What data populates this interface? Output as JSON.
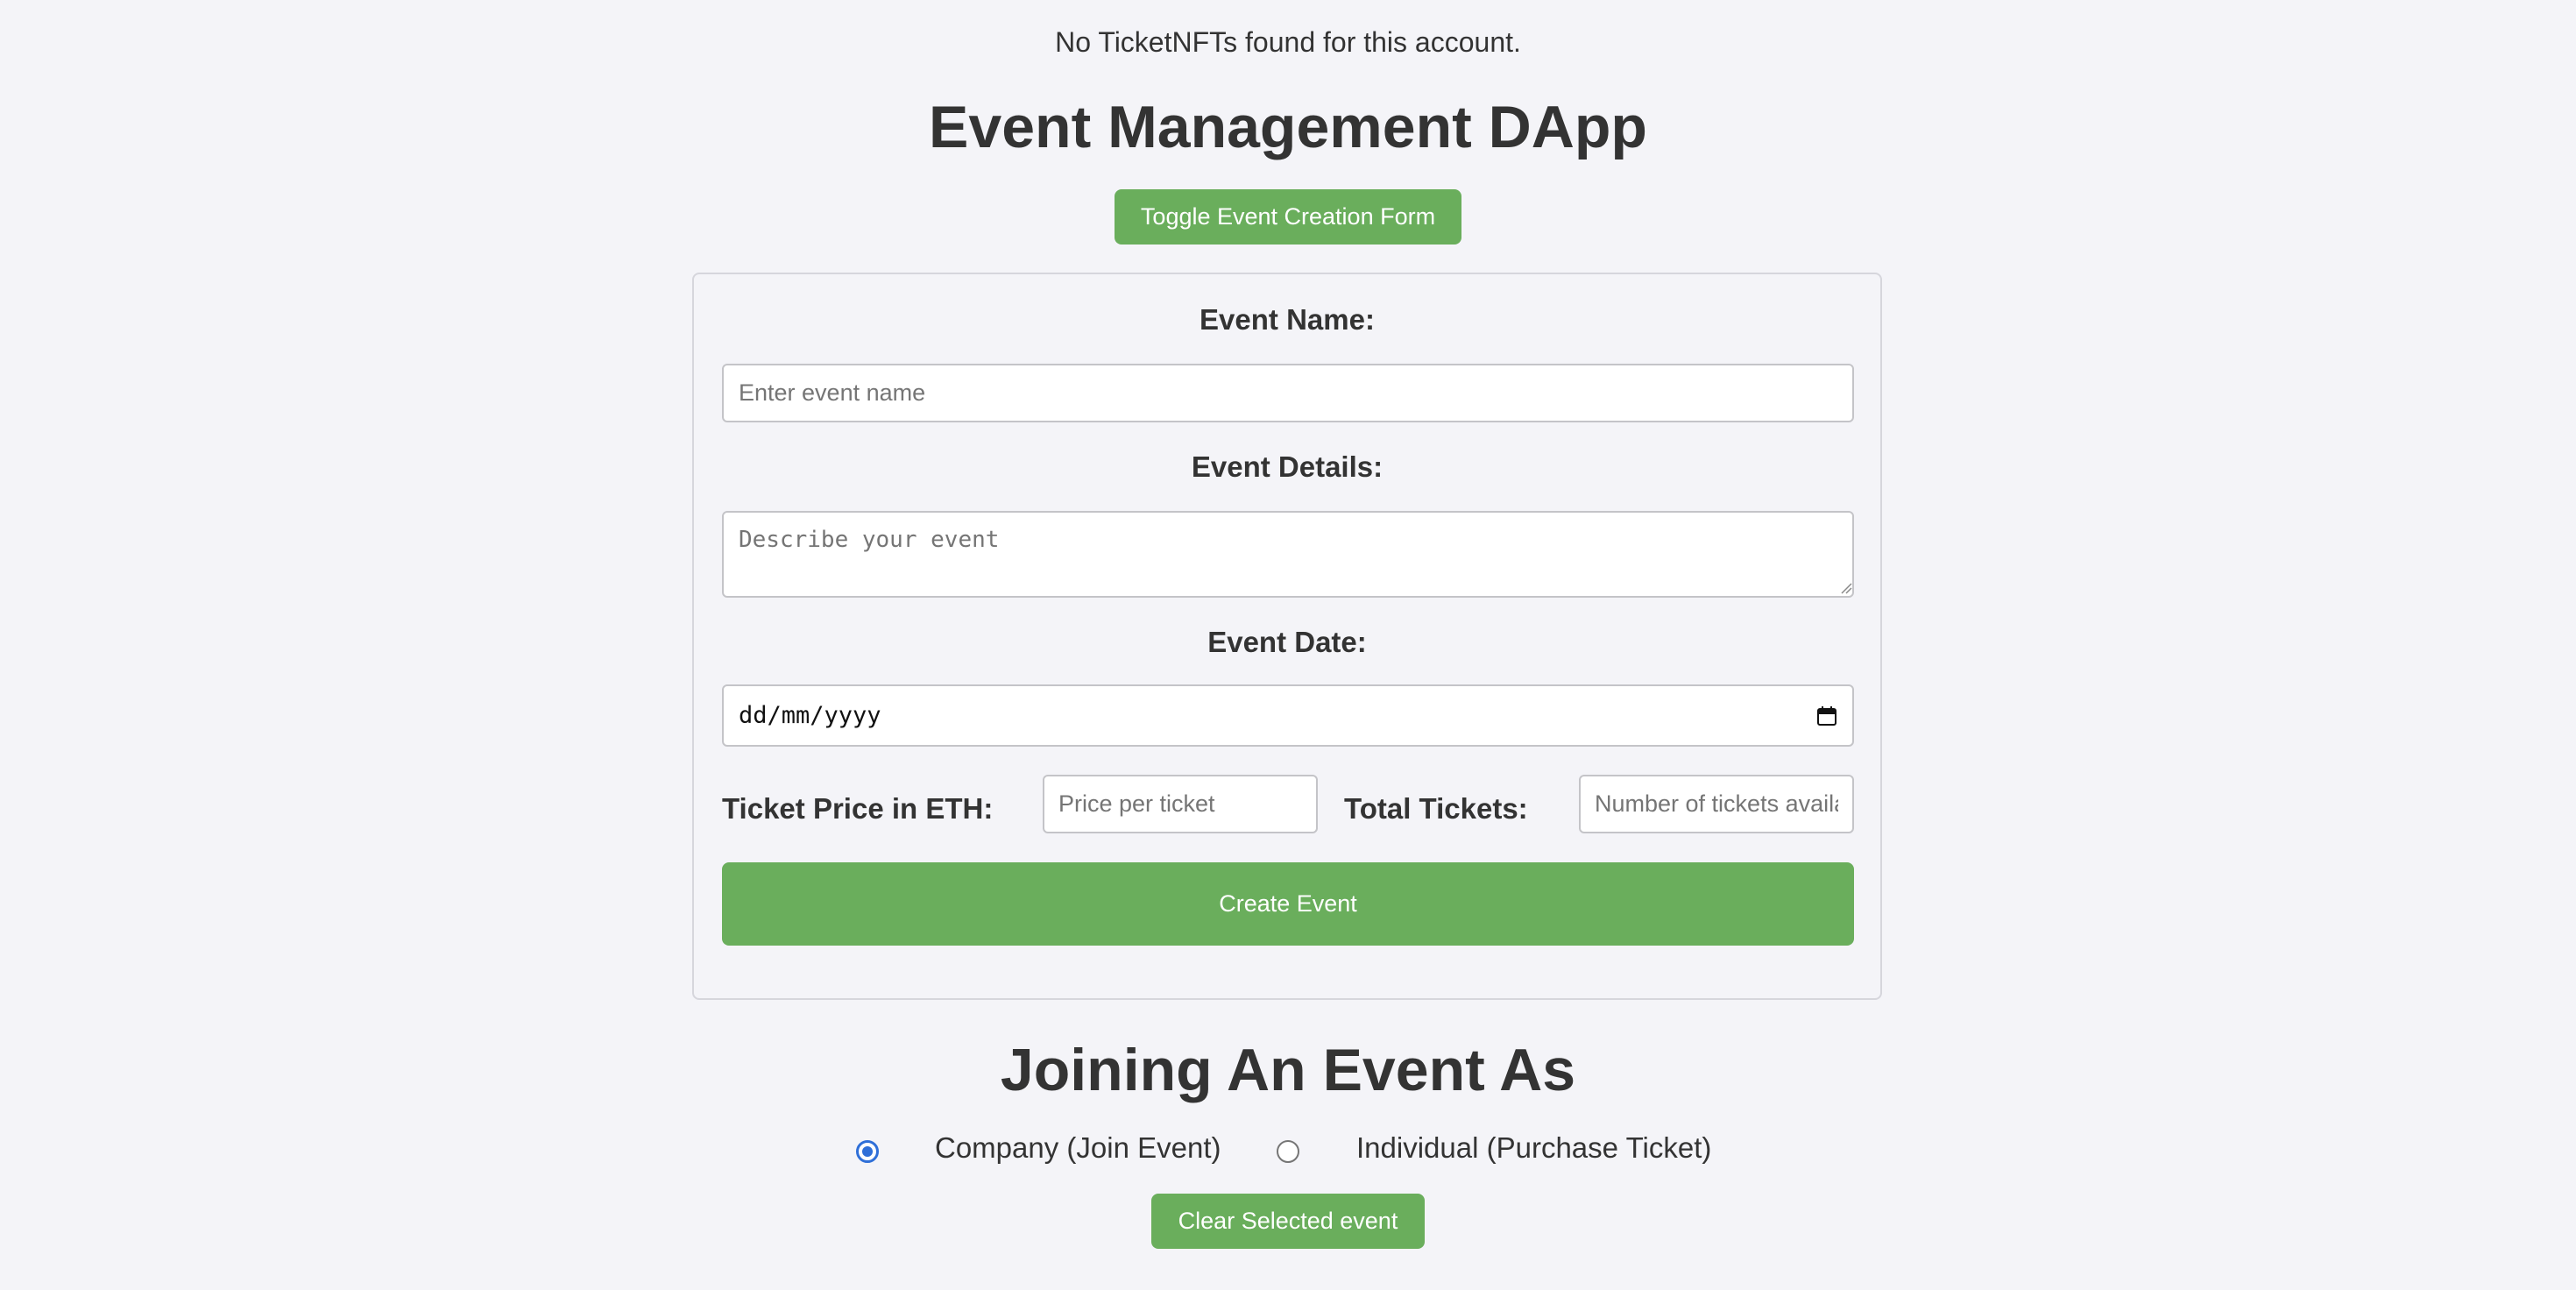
{
  "notice": "No TicketNFTs found for this account.",
  "title": "Event Management DApp",
  "toggle_button": "Toggle Event Creation Form",
  "form": {
    "event_name_label": "Event Name:",
    "event_name_placeholder": "Enter event name",
    "event_details_label": "Event Details:",
    "event_details_placeholder": "Describe your event",
    "event_date_label": "Event Date:",
    "event_date_value": "dd/mm/yyyy",
    "ticket_price_label": "Ticket Price in ETH:",
    "ticket_price_placeholder": "Price per ticket",
    "total_tickets_label": "Total Tickets:",
    "total_tickets_placeholder": "Number of tickets available",
    "create_button": "Create Event"
  },
  "joining": {
    "title": "Joining An Event As",
    "options": [
      {
        "label": "Company (Join Event)",
        "selected": true
      },
      {
        "label": "Individual (Purchase Ticket)",
        "selected": false
      }
    ],
    "clear_button": "Clear Selected event"
  },
  "colors": {
    "accent": "#6aae5c",
    "background": "#f4f4f8",
    "radio_checked": "#2f6fd8"
  }
}
